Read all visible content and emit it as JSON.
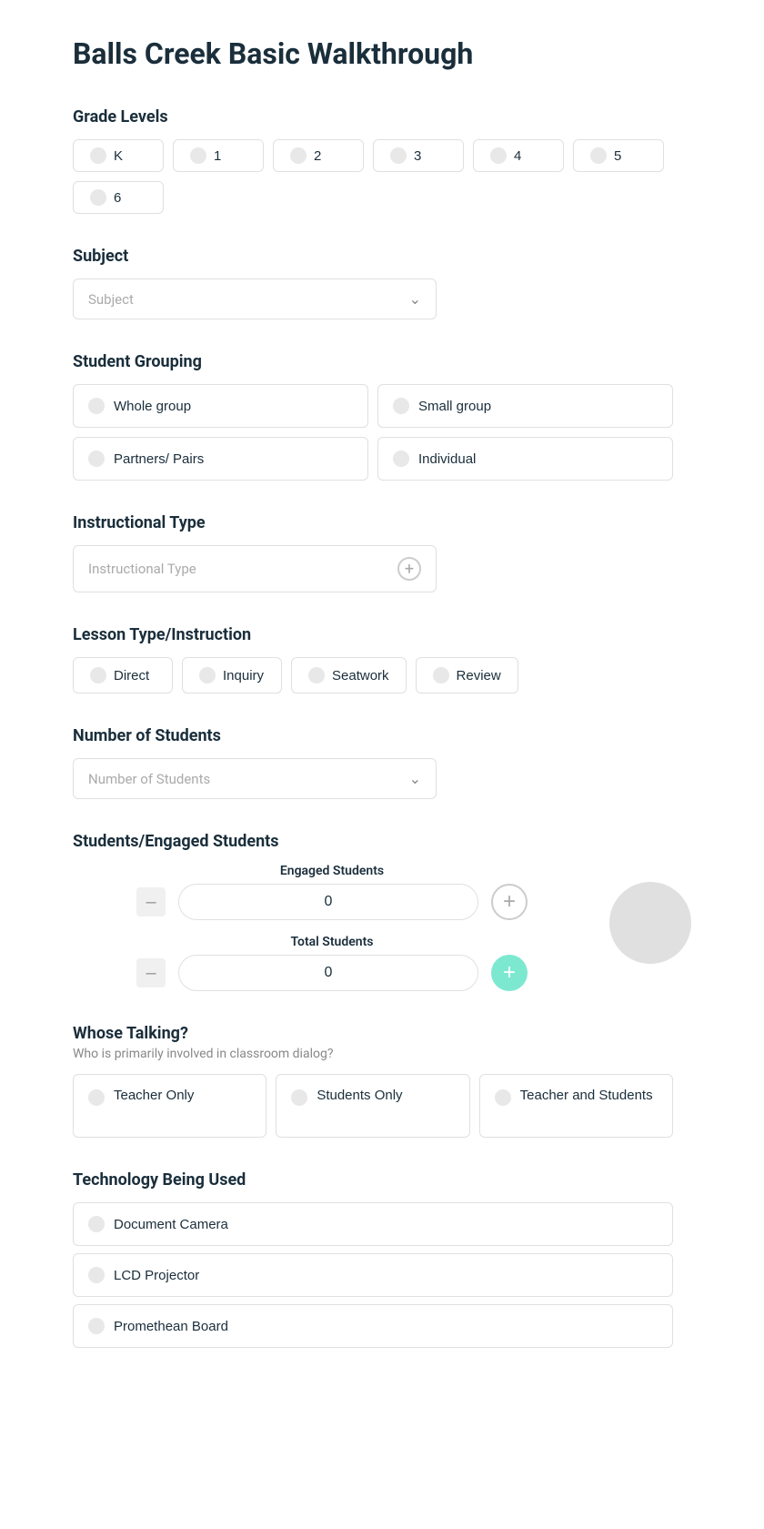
{
  "page": {
    "title": "Balls Creek Basic Walkthrough"
  },
  "grade_levels": {
    "label": "Grade Levels",
    "options": [
      "K",
      "1",
      "2",
      "3",
      "4",
      "5",
      "6"
    ]
  },
  "subject": {
    "label": "Subject",
    "placeholder": "Subject"
  },
  "student_grouping": {
    "label": "Student Grouping",
    "options": [
      "Whole group",
      "Small group",
      "Partners/ Pairs",
      "Individual"
    ]
  },
  "instructional_type": {
    "label": "Instructional Type",
    "placeholder": "Instructional Type"
  },
  "lesson_type": {
    "label": "Lesson Type/Instruction",
    "options": [
      "Direct",
      "Inquiry",
      "Seatwork",
      "Review"
    ]
  },
  "number_of_students": {
    "label": "Number of Students",
    "placeholder": "Number of Students"
  },
  "engaged_students": {
    "label": "Students/Engaged Students",
    "engaged_label": "Engaged Students",
    "total_label": "Total Students",
    "engaged_value": "0",
    "total_value": "0"
  },
  "whose_talking": {
    "label": "Whose Talking?",
    "sublabel": "Who is primarily involved in classroom dialog?",
    "options": [
      "Teacher Only",
      "Students Only",
      "Teacher and Students"
    ]
  },
  "technology": {
    "label": "Technology Being Used",
    "options": [
      "Document Camera",
      "LCD Projector",
      "Promethean Board"
    ]
  }
}
